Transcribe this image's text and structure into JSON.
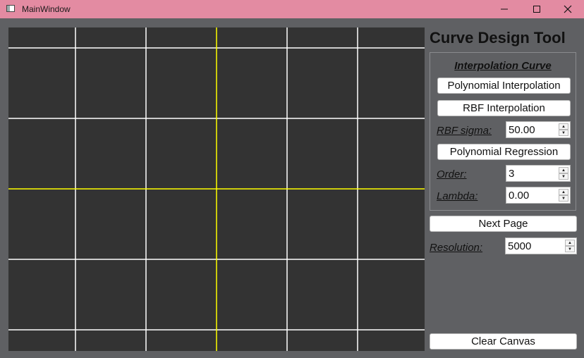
{
  "window": {
    "title": "MainWindow",
    "icon": "app-window-icon",
    "titlebar_color": "#e38ba2"
  },
  "canvas": {
    "background": "#333333",
    "grid_color": "#ffffff",
    "axis_color": "#ffff00"
  },
  "panel": {
    "title": "Curve Design Tool",
    "group_title": "Interpolation Curve",
    "polynomial_interpolation_label": "Polynomial Interpolation",
    "rbf_interpolation_label": "RBF Interpolation",
    "rbf_sigma_label": "RBF sigma:",
    "rbf_sigma_value": "50.00",
    "polynomial_regression_label": "Polynomial Regression",
    "order_label": "Order:",
    "order_value": "3",
    "lambda_label": "Lambda:",
    "lambda_value": "0.00",
    "next_page_label": "Next Page",
    "resolution_label": "Resolution:",
    "resolution_value": "5000",
    "clear_canvas_label": "Clear Canvas"
  }
}
